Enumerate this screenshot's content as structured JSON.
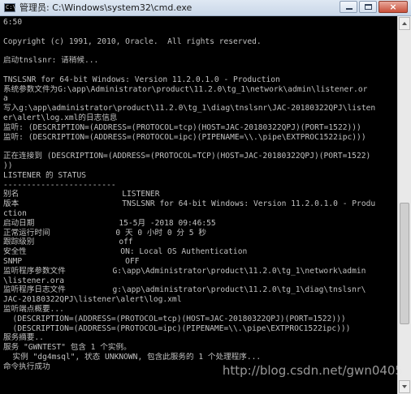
{
  "window": {
    "title": "管理员: C:\\Windows\\system32\\cmd.exe",
    "icon_name": "cmd-icon",
    "icon_text": "C:\\"
  },
  "controls": {
    "minimize": "minimize-icon",
    "maximize": "maximize-icon",
    "close": "×"
  },
  "console": {
    "lines": [
      "6:50",
      "",
      "Copyright (c) 1991, 2010, Oracle.  All rights reserved.",
      "",
      "启动tnslsnr: 请稍候...",
      "",
      "TNSLSNR for 64-bit Windows: Version 11.2.0.1.0 - Production",
      "系统参数文件为G:\\app\\Administrator\\product\\11.2.0\\tg_1\\network\\admin\\listener.or",
      "a",
      "写入g:\\app\\administrator\\product\\11.2.0\\tg_1\\diag\\tnslsnr\\JAC-20180322QPJ\\listen",
      "er\\alert\\log.xml的日志信息",
      "监听: (DESCRIPTION=(ADDRESS=(PROTOCOL=tcp)(HOST=JAC-20180322QPJ)(PORT=1522)))",
      "监听: (DESCRIPTION=(ADDRESS=(PROTOCOL=ipc)(PIPENAME=\\\\.\\pipe\\EXTPROC1522ipc)))",
      "",
      "正在连接到 (DESCRIPTION=(ADDRESS=(PROTOCOL=TCP)(HOST=JAC-20180322QPJ)(PORT=1522)",
      "))",
      "LISTENER 的 STATUS",
      "------------------------",
      "别名                      LISTENER",
      "版本                      TNSLSNR for 64-bit Windows: Version 11.2.0.1.0 - Produ",
      "ction",
      "启动日期                  15-5月 -2018 09:46:55",
      "正常运行时间              0 天 0 小时 0 分 5 秒",
      "跟踪级别                  off",
      "安全性                    ON: Local OS Authentication",
      "SNMP                      OFF",
      "监听程序参数文件          G:\\app\\Administrator\\product\\11.2.0\\tg_1\\network\\admin",
      "\\listener.ora",
      "监听程序日志文件          g:\\app\\administrator\\product\\11.2.0\\tg_1\\diag\\tnslsnr\\",
      "JAC-20180322QPJ\\listener\\alert\\log.xml",
      "监听端点概要...",
      "  (DESCRIPTION=(ADDRESS=(PROTOCOL=tcp)(HOST=JAC-20180322QPJ)(PORT=1522)))",
      "  (DESCRIPTION=(ADDRESS=(PROTOCOL=ipc)(PIPENAME=\\\\.\\pipe\\EXTPROC1522ipc)))",
      "服务摘要..",
      "服务 \"GWNTEST\" 包含 1 个实例。",
      "  实例 \"dg4msql\", 状态 UNKNOWN, 包含此服务的 1 个处理程序...",
      "命令执行成功"
    ]
  },
  "watermark": {
    "text": "http://blog.csdn.net/gwn0405"
  }
}
